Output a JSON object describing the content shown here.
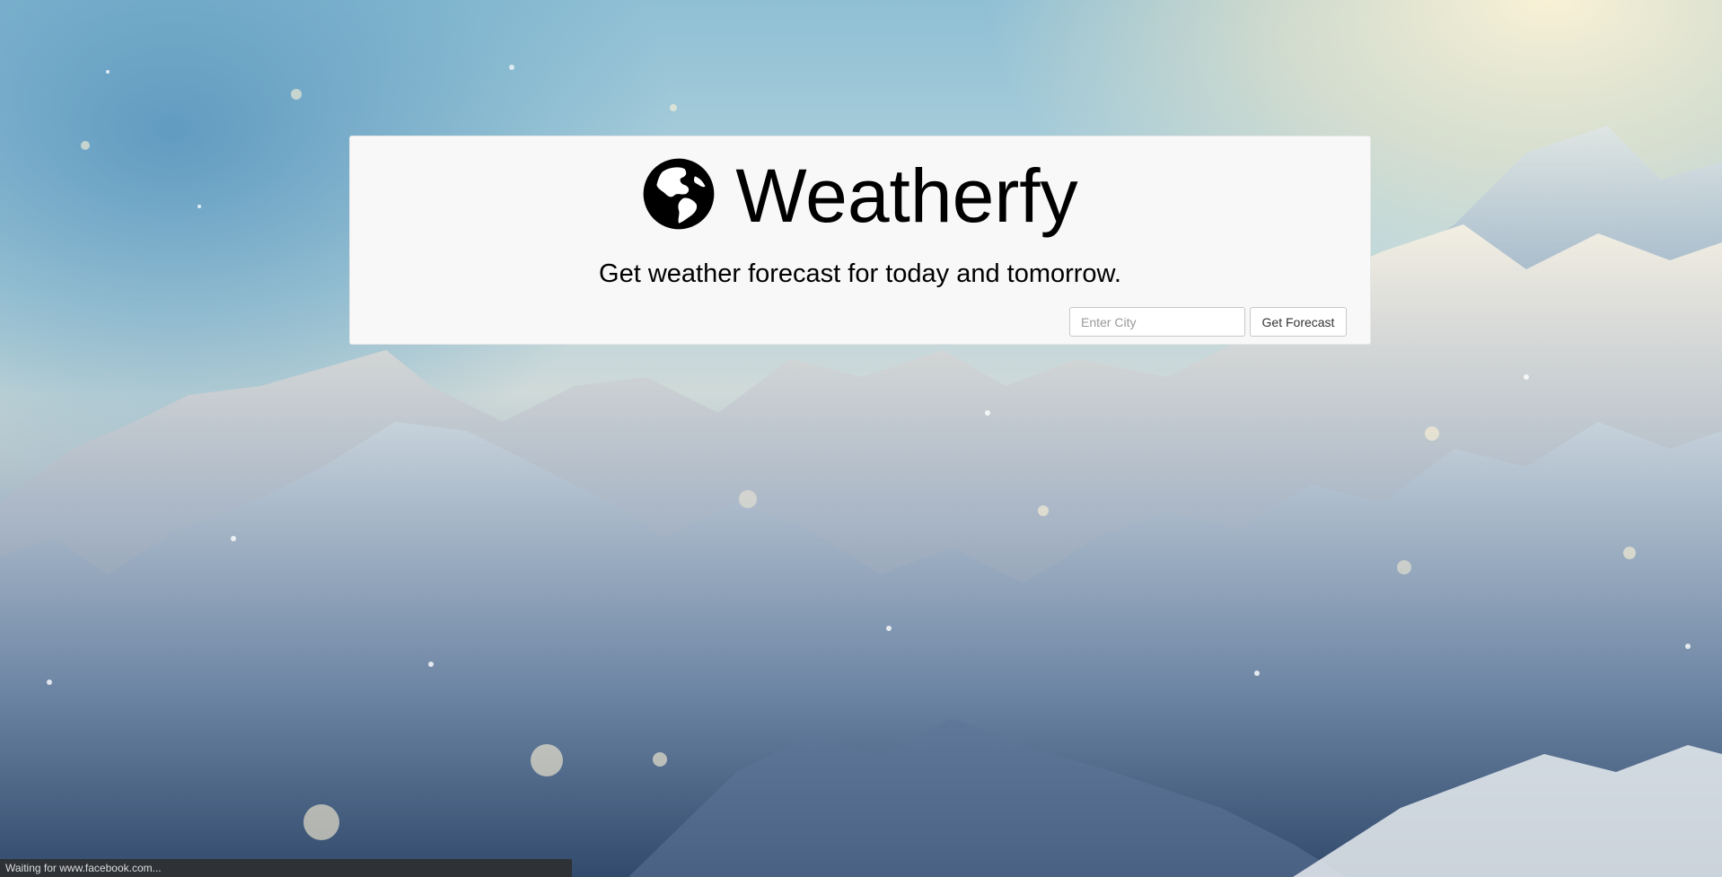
{
  "app": {
    "title": "Weatherfy",
    "subtitle": "Get weather forecast for today and tomorrow."
  },
  "search": {
    "placeholder": "Enter City",
    "value": "",
    "button_label": "Get Forecast"
  },
  "status_bar": {
    "text": "Waiting for www.facebook.com..."
  },
  "icons": {
    "logo": "globe-icon"
  },
  "colors": {
    "panel_background": "#f8f8f8",
    "status_bar_background": "#2e3136",
    "text": "#000000"
  }
}
